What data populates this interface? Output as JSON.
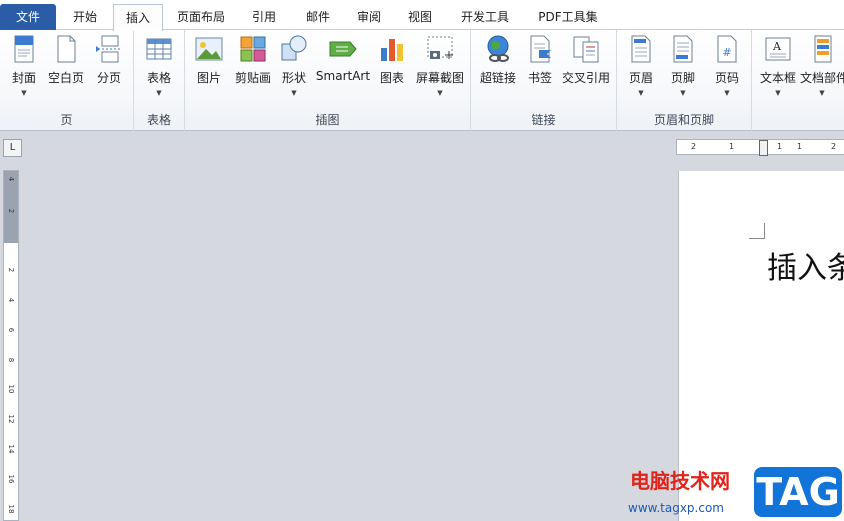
{
  "tabs": {
    "file": "文件",
    "home": "开始",
    "insert": "插入",
    "page_layout": "页面布局",
    "references": "引用",
    "mailings": "邮件",
    "review": "审阅",
    "view": "视图",
    "developer": "开发工具",
    "pdf": "PDF工具集"
  },
  "ribbon": {
    "pages": {
      "label": "页",
      "cover": "封面",
      "blank": "空白页",
      "break": "分页"
    },
    "tables": {
      "label": "表格",
      "table": "表格"
    },
    "illustrations": {
      "label": "插图",
      "picture": "图片",
      "clipart": "剪贴画",
      "shapes": "形状",
      "smartart": "SmartArt",
      "chart": "图表",
      "screenshot": "屏幕截图"
    },
    "links": {
      "label": "链接",
      "hyperlink": "超链接",
      "bookmark": "书签",
      "crossref": "交叉引用"
    },
    "header_footer": {
      "label": "页眉和页脚",
      "header": "页眉",
      "footer": "页脚",
      "page_number": "页码"
    },
    "text": {
      "textbox": "文本框",
      "quickparts": "文档部件"
    }
  },
  "ruler": {
    "tab_selector": "L",
    "vertical_ticks": [
      "4",
      "2",
      "2",
      "4",
      "6",
      "8",
      "10",
      "12",
      "14",
      "16",
      "18"
    ],
    "horizontal_ticks": [
      "2",
      "1",
      "1",
      "1",
      "2"
    ]
  },
  "document": {
    "text": "插入条"
  },
  "watermark": {
    "site": "电脑技术网",
    "url": "www.tagxp.com",
    "logo": "TAG"
  },
  "colors": {
    "file_tab": "#2a5ca8",
    "watermark_red": "#e2231a",
    "watermark_blue": "#1273d8"
  }
}
